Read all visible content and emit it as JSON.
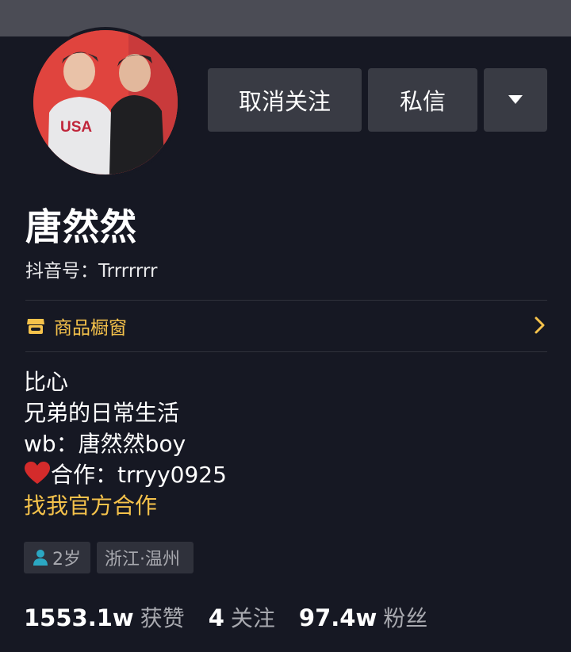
{
  "profile": {
    "nickname": "唐然然",
    "douyin_id": "抖音号：Trrrrrrr"
  },
  "actions": {
    "unfollow_label": "取消关注",
    "message_label": "私信",
    "more_icon": "triangle-down-icon"
  },
  "shop": {
    "label": "商品橱窗",
    "icon": "shop-icon",
    "accent_color": "#f5c24b"
  },
  "bio": {
    "line1": "比心",
    "line2": "兄弟的日常生活",
    "line3": "wb：唐然然boy",
    "line4_emoji": "❤️",
    "line4": "合作：trryy0925",
    "link": "找我官方合作"
  },
  "tags": {
    "age": "2岁",
    "location": "浙江·温州"
  },
  "stats": {
    "likes_count": "1553.1w",
    "likes_label": "获赞",
    "following_count": "4",
    "following_label": "关注",
    "followers_count": "97.4w",
    "followers_label": "粉丝"
  },
  "colors": {
    "background": "#161823",
    "button": "#393b44",
    "accent": "#f5c24b",
    "muted_text": "#a8a9af"
  }
}
